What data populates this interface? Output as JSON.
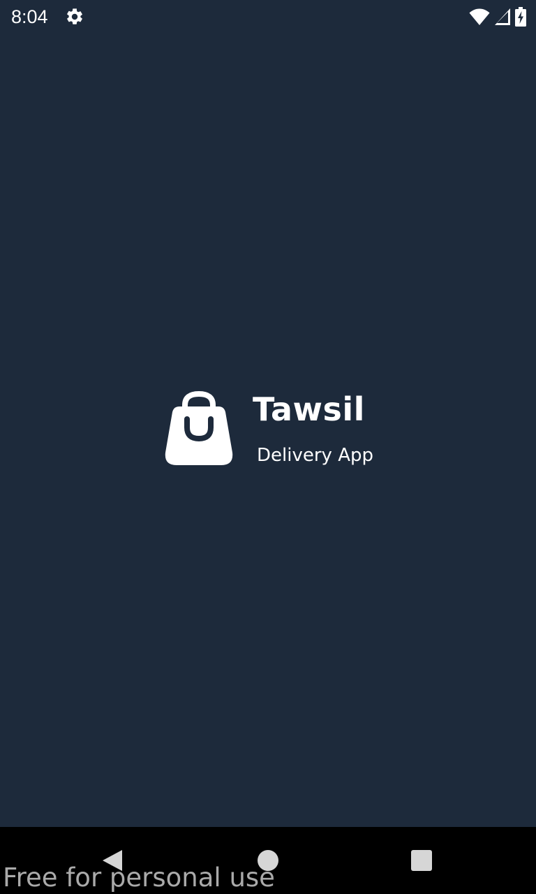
{
  "status_bar": {
    "time": "8:04",
    "icons": [
      "settings-gear-icon",
      "wifi-icon",
      "cellular-signal-icon",
      "battery-charging-icon"
    ]
  },
  "splash": {
    "logo_icon": "shopping-bag-icon",
    "app_name": "Tawsil",
    "tagline": "Delivery App"
  },
  "navigation_bar": {
    "icons": [
      "back-icon",
      "home-icon",
      "recents-icon"
    ]
  },
  "watermark": {
    "text": "Free for personal use"
  },
  "colors": {
    "background": "#1d2a3b",
    "foreground": "#ffffff",
    "nav_bar": "#000000"
  }
}
